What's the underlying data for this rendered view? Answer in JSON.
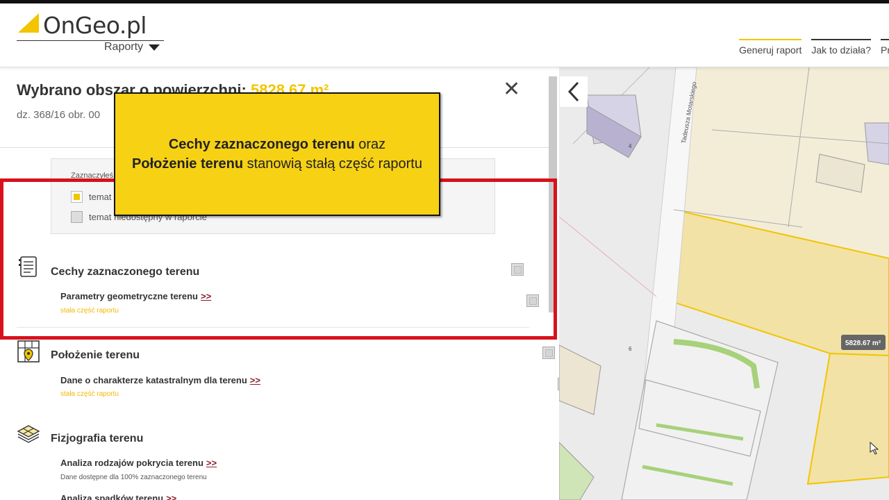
{
  "header": {
    "logo_text": "OnGeo.pl",
    "reports_label": "Raporty",
    "nav": [
      "Generuj raport",
      "Jak to działa?",
      "Pr"
    ]
  },
  "panel": {
    "title_prefix": "Wybrano obszar o powierzchni:",
    "title_area": "5828.67 m²",
    "subtitle": "dz. 368/16 obr. 00",
    "legend": {
      "hint": "Zaznaczyłeś",
      "selected_label": "temat",
      "unavailable_label": "temat niedostępny w raporcie"
    },
    "sections": [
      {
        "title": "Cechy zaznaczonego terenu",
        "sub": "Parametry geometryczne terenu",
        "link": ">>",
        "note": "stała część raportu"
      },
      {
        "title": "Położenie terenu",
        "sub": "Dane o charakterze katastralnym dla terenu",
        "link": ">>",
        "note": "stała część raportu"
      },
      {
        "title": "Fizjografia terenu",
        "sub": "Analiza rodzajów pokrycia terenu",
        "link": ">>",
        "note": "Dane dostępne dla 100% zaznaczonego terenu",
        "sub2": "Analiza spadków terenu",
        "link2": ">>"
      }
    ]
  },
  "tooltip": {
    "bold1": "Cechy zaznaczonego terenu",
    "text1": " oraz",
    "bold2": "Położenie terenu",
    "text2": " stanowią stałą część raportu"
  },
  "map": {
    "street_label": "Tadeusza Motarskiego",
    "number_4": "4",
    "number_6": "6",
    "area_label": "5828.67 m²"
  },
  "colors": {
    "accent": "#f2c500",
    "highlight_border": "#d8111b",
    "link": "#8b1a2b"
  }
}
